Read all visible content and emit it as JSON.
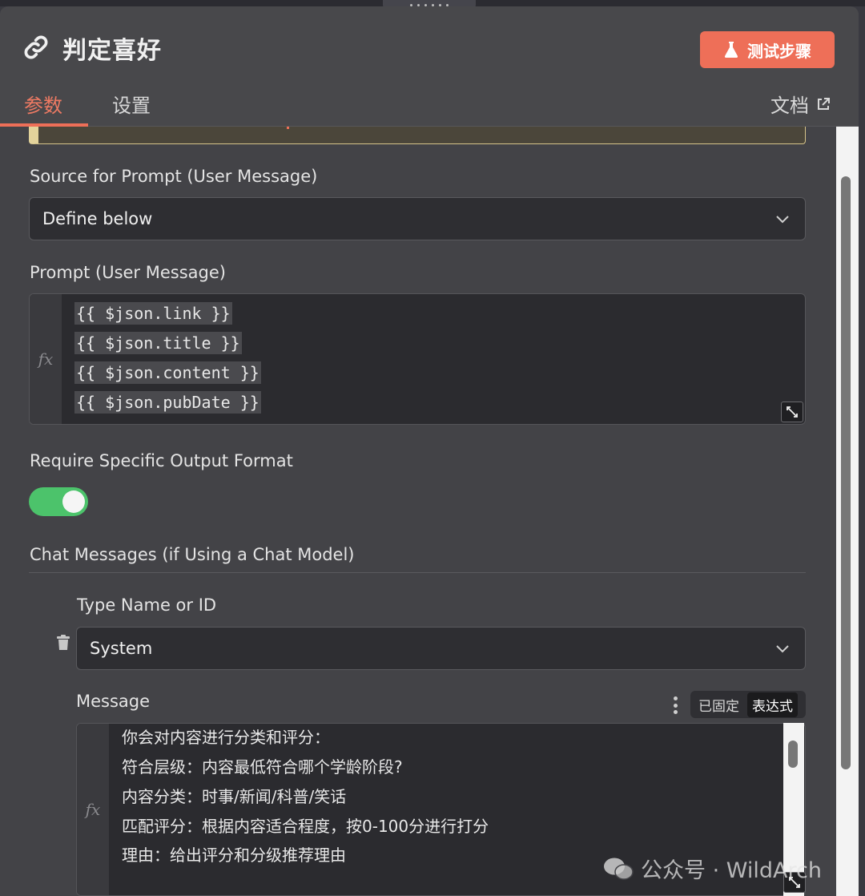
{
  "header": {
    "title": "判定喜好",
    "test_button_label": "测试步骤",
    "tabs": [
      {
        "label": "参数",
        "active": true
      },
      {
        "label": "设置",
        "active": false
      }
    ],
    "docs_label": "文档"
  },
  "fields": {
    "source_label": "Source for Prompt (User Message)",
    "source_value": "Define below",
    "prompt_label": "Prompt (User Message)",
    "prompt_lines": [
      "{{ $json.link }}",
      "{{ $json.title }}",
      "{{ $json.content }}",
      "{{ $json.pubDate }}"
    ],
    "fx_label": "fx",
    "output_format_label": "Require Specific Output Format",
    "output_format_enabled": true,
    "chat_messages_label": "Chat Messages (if Using a Chat Model)",
    "type_label": "Type Name or ID",
    "type_value": "System",
    "message_label": "Message",
    "mode_options": [
      "已固定",
      "表达式"
    ],
    "mode_selected": "表达式",
    "message_lines": [
      "你会对内容进行分类和评分：",
      "符合层级：内容最低符合哪个学龄阶段?",
      "内容分类：时事/新闻/科普/笑话",
      "匹配评分：根据内容适合程度，按0-100分进行打分",
      "理由：给出评分和分级推荐理由"
    ]
  },
  "watermark": "公众号 · WildArch",
  "colors": {
    "accent": "#ee6f58",
    "toggle_on": "#4cc36b",
    "panel_bg": "#434347"
  }
}
